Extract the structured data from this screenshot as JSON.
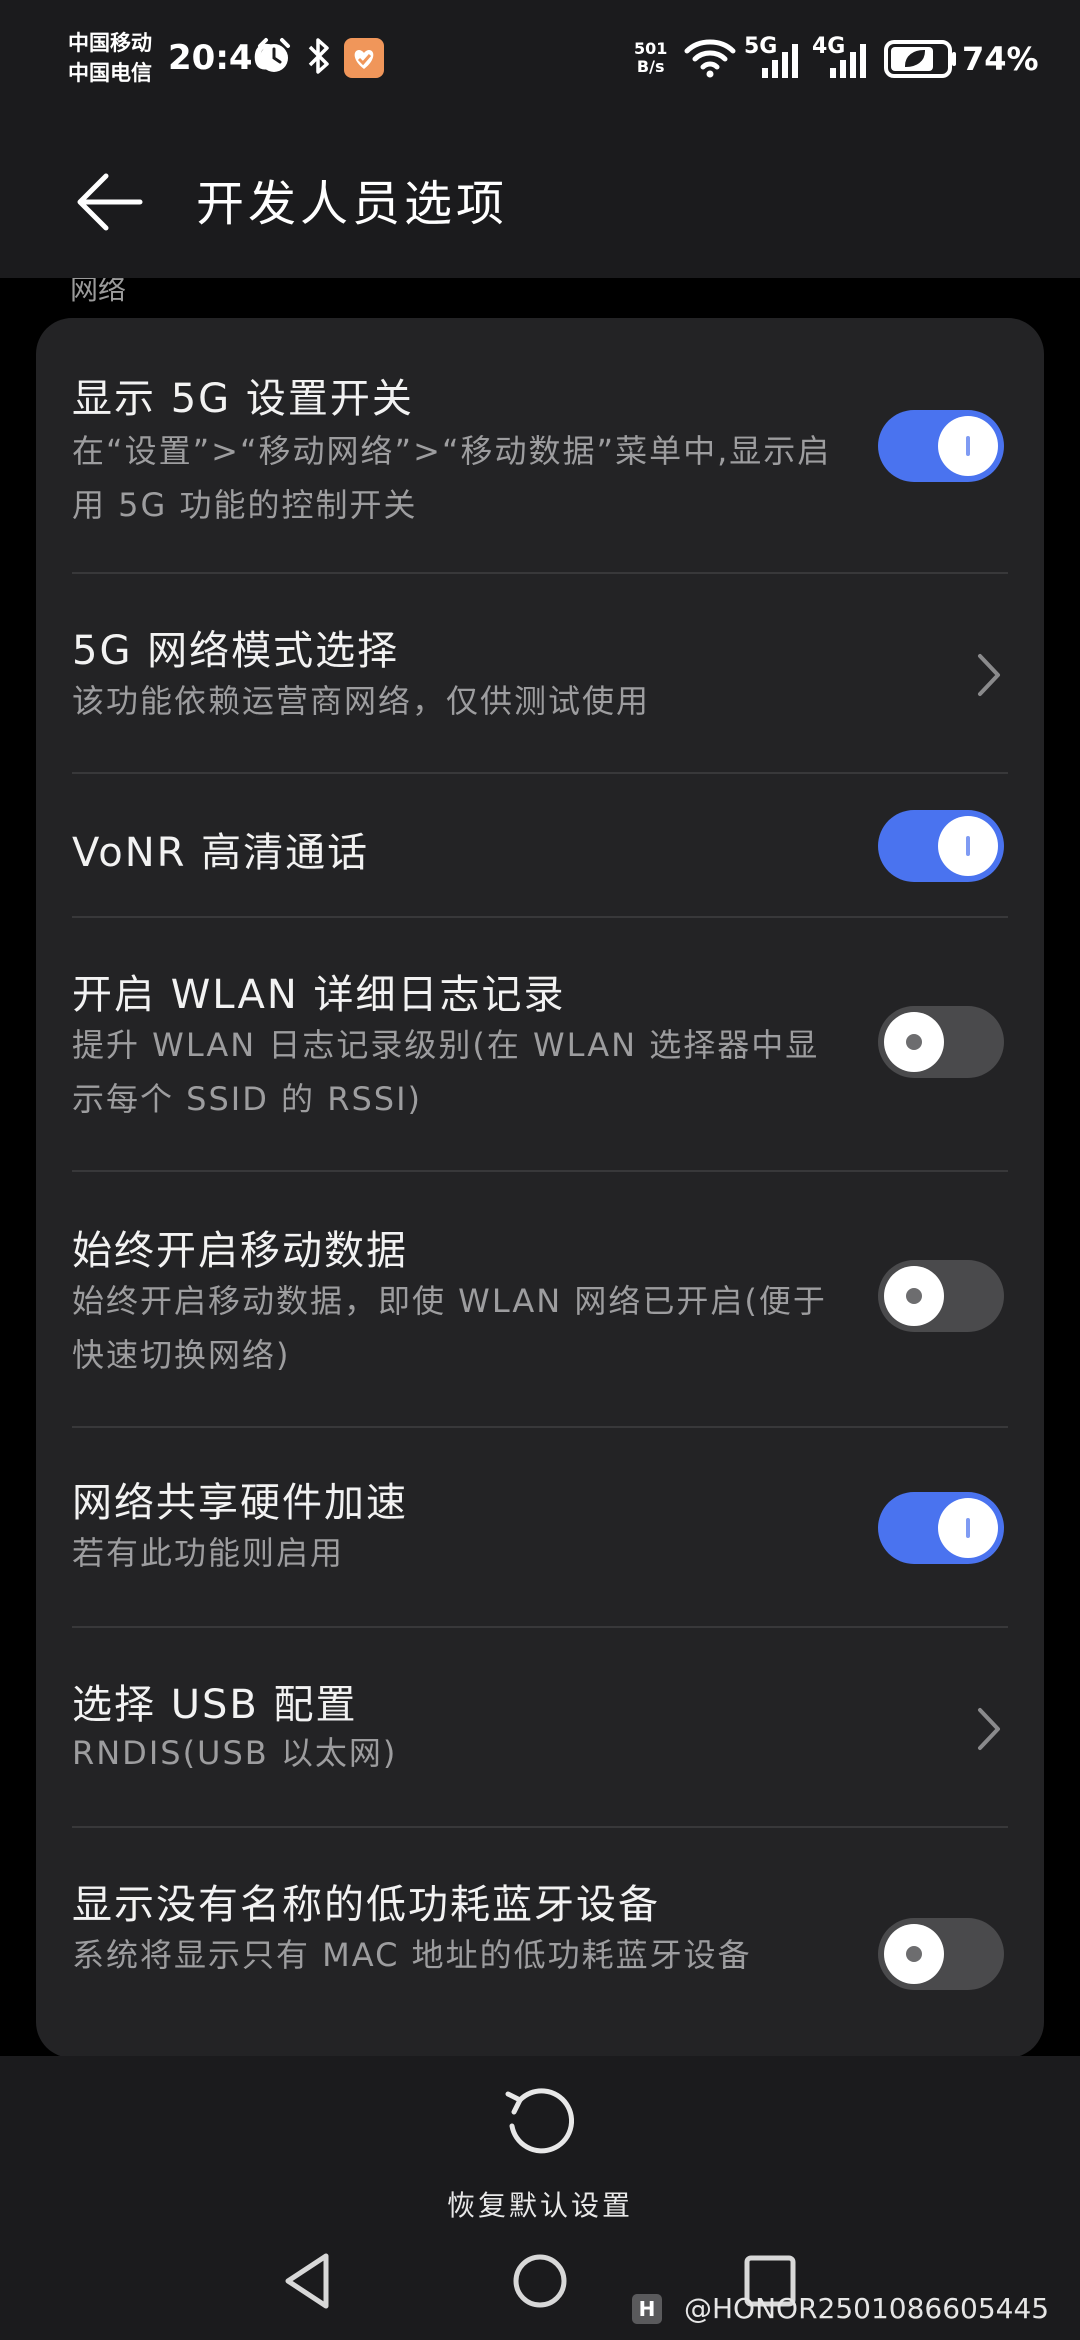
{
  "status_bar": {
    "carrier_1": "中国移动",
    "carrier_2": "中国电信",
    "time": "20:46",
    "net_speed_value": "501",
    "net_speed_unit": "B/s",
    "signal_1": "5G",
    "signal_2": "4G",
    "battery": "74%"
  },
  "app_bar": {
    "title": "开发人员选项"
  },
  "clipped_text": "网络",
  "settings": [
    {
      "title": "显示 5G 设置开关",
      "desc": "在“设置”>“移动网络”>“移动数据”菜单中,显示启用 5G 功能的控制开关",
      "control": "toggle",
      "state": "on"
    },
    {
      "title": "5G 网络模式选择",
      "desc": "该功能依赖运营商网络，仅供测试使用",
      "control": "chevron"
    },
    {
      "title": "VoNR 高清通话",
      "desc": "",
      "control": "toggle",
      "state": "on"
    },
    {
      "title": "开启 WLAN 详细日志记录",
      "desc": "提升 WLAN 日志记录级别(在 WLAN 选择器中显示每个 SSID 的 RSSI)",
      "control": "toggle",
      "state": "off"
    },
    {
      "title": "始终开启移动数据",
      "desc": "始终开启移动数据，即使 WLAN 网络已开启(便于快速切换网络)",
      "control": "toggle",
      "state": "off"
    },
    {
      "title": "网络共享硬件加速",
      "desc": "若有此功能则启用",
      "control": "toggle",
      "state": "on"
    },
    {
      "title": "选择 USB 配置",
      "desc": "RNDIS(USB 以太网)",
      "control": "chevron"
    },
    {
      "title": "显示没有名称的低功耗蓝牙设备",
      "desc": "系统将显示只有 MAC 地址的低功耗蓝牙设备",
      "control": "toggle",
      "state": "off"
    }
  ],
  "bottom": {
    "reset_label": "恢复默认设置"
  },
  "watermark": "@HONOR2501086605445",
  "colors": {
    "toggle_on": "#4a73ef",
    "toggle_off": "#4a4a4c",
    "card_bg": "#232325",
    "bar_bg": "#1b1b1d"
  }
}
